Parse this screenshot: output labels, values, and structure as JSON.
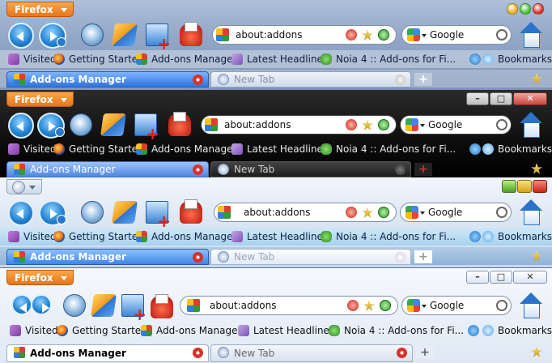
{
  "app": {
    "menu_button": "Firefox",
    "url": "about:addons",
    "search_engine": "Google"
  },
  "bookmarks": {
    "visited": "Visited",
    "getting_started": "Getting Started",
    "addons_manager": "Add-ons Manager",
    "latest_headlines": "Latest Headlines",
    "noia": "Noia 4 :: Add-ons for Fi...",
    "bookmarks": "Bookmarks"
  },
  "tabs": {
    "active": "Add-ons Manager",
    "new_tab": "New Tab"
  },
  "themes": [
    {
      "name": "blue-glossy",
      "accent": "#2d74e0"
    },
    {
      "name": "dark-black",
      "accent": "#000000"
    },
    {
      "name": "light-vista",
      "accent": "#3d86e6"
    },
    {
      "name": "white-clean",
      "accent": "#ffffff"
    }
  ],
  "icons": [
    "back-icon",
    "forward-icon",
    "reload-icon",
    "stop-icon",
    "new-window-icon",
    "print-icon",
    "addon-puzzle-icon",
    "rss-icon",
    "star-icon",
    "go-icon",
    "google-icon",
    "search-magnifier-icon",
    "home-icon",
    "plus-icon",
    "close-icon"
  ]
}
